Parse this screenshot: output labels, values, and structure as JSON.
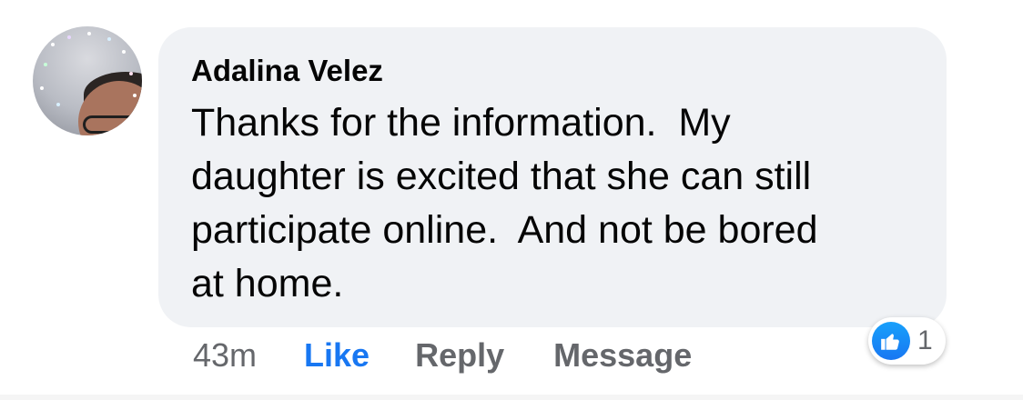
{
  "comment": {
    "author": "Adalina Velez",
    "text": "Thanks for the information.  My\ndaughter is excited that she can still\nparticipate online.  And not be bored\nat home."
  },
  "actions": {
    "time": "43m",
    "like_label": "Like",
    "reply_label": "Reply",
    "message_label": "Message"
  },
  "reactions": {
    "icon": "thumbs-up-icon",
    "count": "1"
  },
  "colors": {
    "bubble": "#f0f2f5",
    "like_active": "#1877f2",
    "secondary_text": "#65676b",
    "primary_text": "#050505"
  }
}
